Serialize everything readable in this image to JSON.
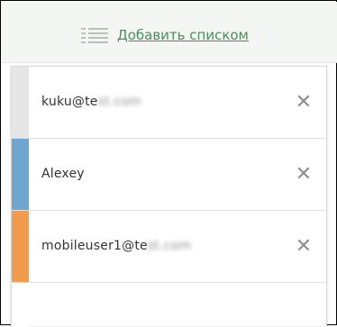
{
  "header": {
    "add_label": "Добавить списком",
    "icon": "list-icon"
  },
  "users": [
    {
      "label": "kuku@te",
      "label_blurred": "st.com",
      "accent_color": "#e6e6e6",
      "remove_icon": "close-icon"
    },
    {
      "label": "Alexey",
      "label_blurred": "",
      "accent_color": "#6fa6cf",
      "remove_icon": "close-icon"
    },
    {
      "label": "mobileuser1@te",
      "label_blurred": "st.com",
      "accent_color": "#f39b4d",
      "remove_icon": "close-icon"
    }
  ],
  "colors": {
    "link": "#4a8f5a",
    "header_bg": "#f4f6f4",
    "close_icon": "#8e8e8e"
  }
}
